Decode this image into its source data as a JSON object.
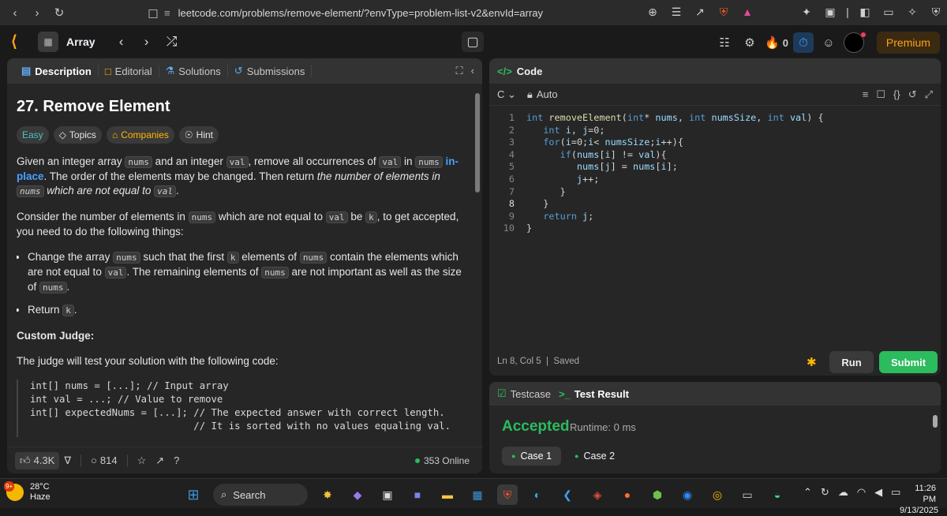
{
  "browser": {
    "url": "leetcode.com/problems/remove-element/?envType=problem-list-v2&envId=array",
    "brave_badge": "4",
    "alert_badge": "1"
  },
  "nav": {
    "problem_list": "Array",
    "premium": "Premium",
    "streak": "0"
  },
  "left_tabs": [
    "Description",
    "Editorial",
    "Solutions",
    "Submissions"
  ],
  "problem": {
    "title": "27. Remove Element",
    "difficulty": "Easy",
    "tags": [
      "Topics",
      "Companies",
      "Hint"
    ],
    "p1_a": "Given an integer array ",
    "p1_nums": "nums",
    "p1_b": " and an integer ",
    "p1_val": "val",
    "p1_c": ", remove all occurrences of ",
    "p1_d": " in ",
    "p1_link": "in-place",
    "p1_e": ". The order of the elements may be changed. Then return ",
    "p1_em": "the number of elements in ",
    "p1_em2": " which are not equal to ",
    "p1_f": ".",
    "p2_a": "Consider the number of elements in ",
    "p2_b": " which are not equal to ",
    "p2_c": " be ",
    "p2_k": "k",
    "p2_d": ", to get accepted, you need to do the following things:",
    "b1_a": "Change the array ",
    "b1_b": " such that the first ",
    "b1_c": " elements of ",
    "b1_d": " contain the elements which are not equal to ",
    "b1_e": ". The remaining elements of ",
    "b1_f": " are not important as well as the size of ",
    "b1_g": ".",
    "b2_a": "Return ",
    "b2_b": ".",
    "custom_judge": "Custom Judge:",
    "judge_text": "The judge will test your solution with the following code:",
    "judge_code": "int[] nums = [...]; // Input array\nint val = ...; // Value to remove\nint[] expectedNums = [...]; // The expected answer with correct length.\n                            // It is sorted with no values equaling val.\n\nint k = removeElement(nums, val); // Calls your implementation"
  },
  "footer": {
    "likes": "4.3K",
    "comments": "814",
    "online": "353 Online"
  },
  "code": {
    "tab": "Code",
    "lang": "C",
    "mode": "Auto",
    "line_numbers": [
      "1",
      "2",
      "3",
      "4",
      "5",
      "6",
      "7",
      "8",
      "9",
      "10"
    ],
    "status_pos": "Ln 8, Col 5",
    "status_saved": "Saved",
    "run": "Run",
    "submit": "Submit"
  },
  "tests": {
    "tab_testcase": "Testcase",
    "tab_result": "Test Result",
    "verdict": "Accepted",
    "runtime": "Runtime: 0 ms",
    "cases": [
      "Case 1",
      "Case 2"
    ]
  },
  "taskbar": {
    "temp": "28°C",
    "weather": "Haze",
    "weather_badge": "9+",
    "search": "Search",
    "time": "11:26 PM",
    "date": "9/13/2025"
  }
}
